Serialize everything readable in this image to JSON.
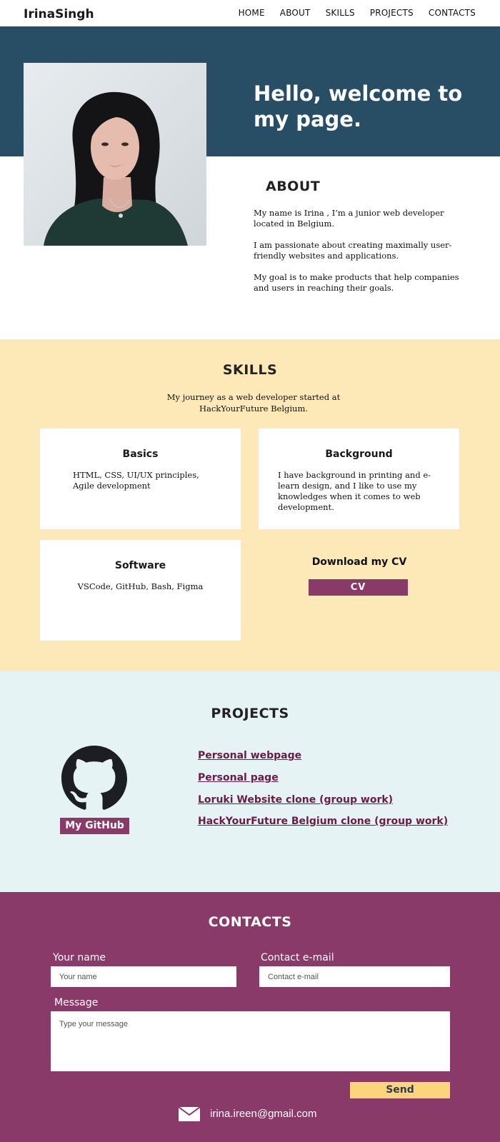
{
  "nav": {
    "brand": "IrinaSingh",
    "links": [
      "HOME",
      "ABOUT",
      "SKILLS",
      "PROJECTS",
      "CONTACTS"
    ]
  },
  "hero": {
    "title": "Hello, welcome to my page."
  },
  "about": {
    "heading": "ABOUT",
    "paragraphs": [
      "My name is Irina , I’m a junior web developer located in Belgium.",
      "I am passionate about creating maximally user-friendly websites and applications.",
      "My goal is to make products that  help companies and users in reaching their goals."
    ]
  },
  "skills": {
    "heading": "SKILLS",
    "intro": "My journey as a web developer started at HackYourFuture Belgium.",
    "cards": [
      {
        "title": "Basics",
        "text": "HTML, CSS, UI/UX principles, Agile development"
      },
      {
        "title": "Background",
        "text": "I have background in printing and e-learn design, and I like to use my knowledges when it comes to web development."
      },
      {
        "title": "Software",
        "text": "VSCode, GitHub, Bash, Figma"
      }
    ],
    "cv_title": "Download my CV",
    "cv_button": "CV"
  },
  "projects": {
    "heading": "PROJECTS",
    "github_button": "My GitHub",
    "links": [
      "Personal webpage",
      "Personal page",
      "Loruki Website clone (group work)",
      "HackYourFuture Belgium clone (group work)"
    ]
  },
  "contacts": {
    "heading": "CONTACTS",
    "name_label": "Your name",
    "name_placeholder": "Your name",
    "email_label": "Contact e-mail",
    "email_placeholder": "Contact e-mail",
    "message_label": "Message",
    "message_placeholder": "Type your message",
    "send_button": "Send",
    "email": "irina.ireen@gmail.com"
  },
  "colors": {
    "hero_bg": "#284e66",
    "skills_bg": "#fde9b8",
    "projects_bg": "#e6f3f4",
    "contacts_bg": "#8a3a69",
    "accent": "#8a3a69",
    "send_bg": "#fcd57a",
    "link": "#6a1b48"
  },
  "icons": {
    "github": "github-icon",
    "mail": "envelope-icon"
  }
}
